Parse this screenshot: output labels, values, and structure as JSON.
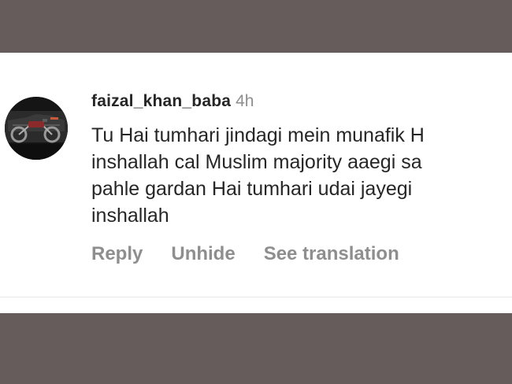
{
  "comment": {
    "username": "faizal_khan_baba",
    "timestamp": "4h",
    "lines": [
      "Tu Hai tumhari jindagi mein munafik H",
      "inshallah cal Muslim majority aaegi sa",
      "pahle gardan Hai tumhari udai jayegi",
      "inshallah"
    ]
  },
  "actions": {
    "reply": "Reply",
    "unhide": "Unhide",
    "see_translation": "See translation"
  },
  "colors": {
    "background_band": "#655c5b",
    "card": "#ffffff",
    "text_primary": "#262626",
    "text_secondary": "#8e8e8e"
  },
  "icons": {
    "avatar": "profile-picture-motorcycle"
  }
}
